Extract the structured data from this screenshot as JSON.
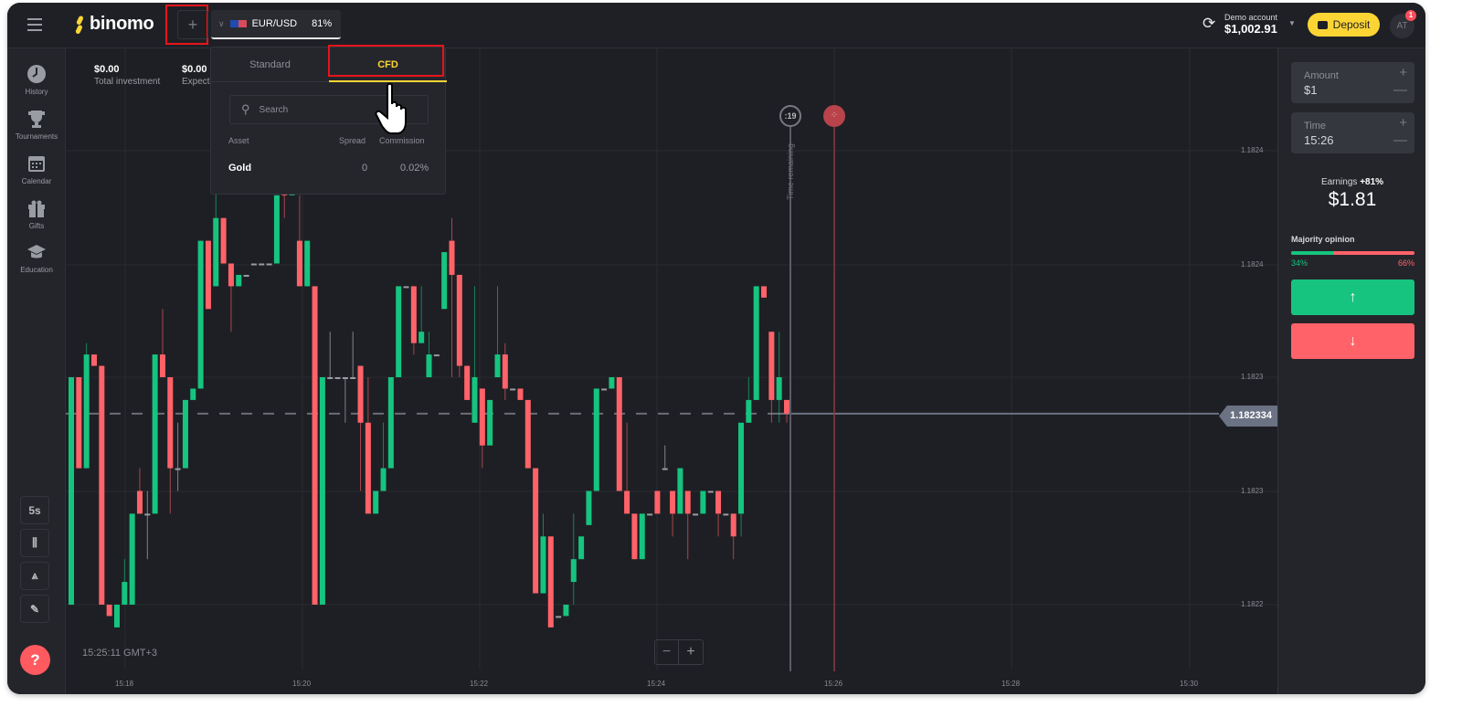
{
  "header": {
    "logo": "binomo",
    "add_asset": "+",
    "asset": "EUR/USD",
    "asset_payout": "81%",
    "account_type": "Demo account",
    "balance": "$1,002.91",
    "deposit": "Deposit",
    "avatar": "AT",
    "notif_count": "1"
  },
  "sidebar": {
    "items": [
      {
        "label": "History",
        "icon": "clock-icon"
      },
      {
        "label": "Tournaments",
        "icon": "trophy-icon"
      },
      {
        "label": "Calendar",
        "icon": "calendar-icon"
      },
      {
        "label": "Gifts",
        "icon": "gift-icon"
      },
      {
        "label": "Education",
        "icon": "graduation-cap-icon"
      }
    ],
    "tools": {
      "timeframe": "5s"
    },
    "help": "?"
  },
  "stats": {
    "total_investment_value": "$0.00",
    "total_investment_label": "Total investment",
    "expected_value": "$0.00",
    "expected_label": "Expecte"
  },
  "dropdown": {
    "tabs": [
      "Standard",
      "CFD"
    ],
    "active_tab": "CFD",
    "search_placeholder": "Search",
    "columns": [
      "Asset",
      "Spread",
      "Commission"
    ],
    "rows": [
      {
        "asset": "Gold",
        "spread": "0",
        "commission": "0.02%"
      }
    ]
  },
  "chart": {
    "clock": "15:25:11 GMT+3",
    "current_price": "1.182334",
    "timer": ":19",
    "time_remaining": "Time remaining",
    "zoom_out": "−",
    "zoom_in": "+",
    "price_labels": [
      "1.1824",
      "1.1824",
      "1.1823",
      "1.1823",
      "1.1822"
    ],
    "time_labels": [
      "15:18",
      "15:20",
      "15:22",
      "15:24",
      "15:26",
      "15:28",
      "15:30"
    ],
    "colors": {
      "up": "#16c47f",
      "down": "#ff6369",
      "flat": "#9a9ca3"
    }
  },
  "chart_data": {
    "type": "candlestick",
    "interval": "5s",
    "price_range": [
      1.18221,
      1.18248
    ],
    "current": 1.182334,
    "candles": [
      [
        1.18225,
        1.18235,
        1.18225,
        1.18235
      ],
      [
        1.18235,
        1.18235,
        1.18231,
        1.18231
      ],
      [
        1.18231,
        1.182365,
        1.18231,
        1.18236
      ],
      [
        1.18236,
        1.18236,
        1.182355,
        1.182355
      ],
      [
        1.182355,
        1.182355,
        1.18225,
        1.18225
      ],
      [
        1.18225,
        1.18225,
        1.182245,
        1.182245
      ],
      [
        1.18224,
        1.18225,
        1.18224,
        1.18225
      ],
      [
        1.18225,
        1.18227,
        1.18225,
        1.18226
      ],
      [
        1.18225,
        1.18229,
        1.18225,
        1.18229
      ],
      [
        1.1823,
        1.18231,
        1.18229,
        1.18229
      ],
      [
        1.18229,
        1.1823,
        1.18227,
        1.18229
      ],
      [
        1.18229,
        1.18236,
        1.18229,
        1.18236
      ],
      [
        1.18236,
        1.18238,
        1.18235,
        1.18235
      ],
      [
        1.18235,
        1.18235,
        1.18229,
        1.18231
      ],
      [
        1.18231,
        1.18233,
        1.1823,
        1.18231
      ],
      [
        1.18231,
        1.18234,
        1.18231,
        1.18234
      ],
      [
        1.18234,
        1.182345,
        1.18234,
        1.182345
      ],
      [
        1.182345,
        1.18241,
        1.182345,
        1.18241
      ],
      [
        1.18241,
        1.18241,
        1.18238,
        1.18238
      ],
      [
        1.18239,
        1.182435,
        1.18239,
        1.18242
      ],
      [
        1.18242,
        1.18242,
        1.1824,
        1.1824
      ],
      [
        1.1824,
        1.1824,
        1.18237,
        1.18239
      ],
      [
        1.18239,
        1.182395,
        1.18239,
        1.182395
      ],
      [
        1.182395,
        1.182395,
        1.182395,
        1.182395
      ],
      [
        1.1824,
        1.1824,
        1.1824,
        1.1824
      ],
      [
        1.1824,
        1.1824,
        1.1824,
        1.1824
      ],
      [
        1.1824,
        1.1824,
        1.1824,
        1.1824
      ],
      [
        1.1824,
        1.18243,
        1.1824,
        1.18243
      ],
      [
        1.182432,
        1.182432,
        1.18242,
        1.18243
      ],
      [
        1.18243,
        1.182432,
        1.18243,
        1.182432
      ],
      [
        1.18241,
        1.18243,
        1.18239,
        1.18239
      ],
      [
        1.18239,
        1.18241,
        1.18239,
        1.18241
      ],
      [
        1.18239,
        1.18239,
        1.18225,
        1.18225
      ],
      [
        1.18225,
        1.18235,
        1.18225,
        1.18235
      ],
      [
        1.18235,
        1.18237,
        1.18235,
        1.18235
      ],
      [
        1.18235,
        1.18235,
        1.18235,
        1.18235
      ],
      [
        1.18235,
        1.18235,
        1.18233,
        1.18235
      ],
      [
        1.18235,
        1.18237,
        1.18235,
        1.18235
      ],
      [
        1.182355,
        1.182355,
        1.1823,
        1.18233
      ],
      [
        1.18233,
        1.18235,
        1.18229,
        1.18229
      ],
      [
        1.18229,
        1.1823,
        1.18229,
        1.1823
      ],
      [
        1.1823,
        1.18233,
        1.1823,
        1.18231
      ],
      [
        1.18231,
        1.18235,
        1.18231,
        1.18235
      ],
      [
        1.18235,
        1.18239,
        1.18235,
        1.18239
      ],
      [
        1.18239,
        1.18239,
        1.18239,
        1.18239
      ],
      [
        1.18239,
        1.18239,
        1.18236,
        1.182365
      ],
      [
        1.182365,
        1.18239,
        1.182365,
        1.18237
      ],
      [
        1.18235,
        1.18237,
        1.18235,
        1.18236
      ],
      [
        1.18236,
        1.18236,
        1.18236,
        1.18236
      ],
      [
        1.18238,
        1.182405,
        1.18238,
        1.182405
      ],
      [
        1.18241,
        1.18242,
        1.18235,
        1.182395
      ],
      [
        1.182395,
        1.182395,
        1.18235,
        1.182355
      ],
      [
        1.182355,
        1.182355,
        1.18234,
        1.18234
      ],
      [
        1.18233,
        1.18239,
        1.18233,
        1.18235
      ],
      [
        1.182345,
        1.182345,
        1.18231,
        1.18232
      ],
      [
        1.18232,
        1.18234,
        1.18232,
        1.18234
      ],
      [
        1.18235,
        1.18239,
        1.18235,
        1.18236
      ],
      [
        1.18236,
        1.182365,
        1.18234,
        1.182345
      ],
      [
        1.182345,
        1.182345,
        1.182345,
        1.182345
      ],
      [
        1.182345,
        1.182345,
        1.18234,
        1.18234
      ],
      [
        1.18234,
        1.18234,
        1.18231,
        1.18231
      ],
      [
        1.18231,
        1.18231,
        1.182255,
        1.182255
      ],
      [
        1.182255,
        1.18229,
        1.182255,
        1.18228
      ],
      [
        1.18228,
        1.18228,
        1.18224,
        1.18224
      ],
      [
        1.182245,
        1.182245,
        1.182245,
        1.182245
      ],
      [
        1.182245,
        1.18225,
        1.182245,
        1.18225
      ],
      [
        1.18226,
        1.18229,
        1.18225,
        1.18227
      ],
      [
        1.18227,
        1.18228,
        1.18227,
        1.18228
      ],
      [
        1.182285,
        1.1823,
        1.182285,
        1.1823
      ],
      [
        1.1823,
        1.182345,
        1.1823,
        1.182345
      ],
      [
        1.182345,
        1.182345,
        1.182345,
        1.182345
      ],
      [
        1.182345,
        1.18235,
        1.182345,
        1.18235
      ],
      [
        1.18235,
        1.18235,
        1.1823,
        1.1823
      ],
      [
        1.1823,
        1.18233,
        1.18229,
        1.18229
      ],
      [
        1.18229,
        1.18229,
        1.18227,
        1.18227
      ],
      [
        1.18227,
        1.18229,
        1.18227,
        1.18229
      ],
      [
        1.18229,
        1.18229,
        1.18229,
        1.18229
      ],
      [
        1.1823,
        1.1823,
        1.18229,
        1.18229
      ],
      [
        1.18231,
        1.18232,
        1.18231,
        1.18231
      ],
      [
        1.1823,
        1.1823,
        1.18228,
        1.18229
      ],
      [
        1.18229,
        1.18231,
        1.18229,
        1.18231
      ],
      [
        1.1823,
        1.1823,
        1.18227,
        1.18229
      ],
      [
        1.18229,
        1.18229,
        1.18229,
        1.18229
      ],
      [
        1.18229,
        1.1823,
        1.18229,
        1.1823
      ],
      [
        1.1823,
        1.1823,
        1.1823,
        1.1823
      ],
      [
        1.1823,
        1.1823,
        1.18228,
        1.18229
      ],
      [
        1.18229,
        1.18229,
        1.18229,
        1.18229
      ],
      [
        1.18229,
        1.18229,
        1.18227,
        1.18228
      ],
      [
        1.18229,
        1.18233,
        1.18228,
        1.18233
      ],
      [
        1.18233,
        1.18235,
        1.18233,
        1.18234
      ],
      [
        1.18234,
        1.18239,
        1.18234,
        1.18239
      ],
      [
        1.18239,
        1.18239,
        1.182385,
        1.182385
      ],
      [
        1.18237,
        1.18237,
        1.18233,
        1.18234
      ],
      [
        1.18234,
        1.18237,
        1.18233,
        1.18235
      ],
      [
        1.18234,
        1.18234,
        1.18233,
        1.182334
      ]
    ]
  },
  "trade": {
    "amount_label": "Amount",
    "amount": "$1",
    "time_label": "Time",
    "time": "15:26",
    "earnings_label": "Earnings",
    "earnings_pct": "+81%",
    "earnings_value": "$1.81",
    "majority_label": "Majority opinion",
    "majority_up": "34%",
    "majority_down": "66%",
    "majority_up_fraction": 0.34,
    "colors": {
      "up": "#16c47f",
      "down": "#ff6369",
      "deposit": "#fcd535",
      "highlight": "#e8141b"
    }
  }
}
